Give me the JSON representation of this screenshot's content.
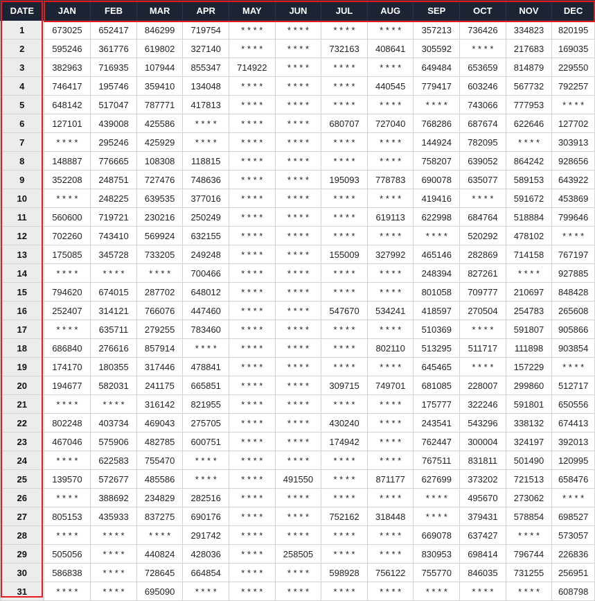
{
  "table": {
    "date_header": "DATE",
    "months": [
      "JAN",
      "FEB",
      "MAR",
      "APR",
      "MAY",
      "JUN",
      "JUL",
      "AUG",
      "SEP",
      "OCT",
      "NOV",
      "DEC"
    ],
    "rows": [
      {
        "date": "1",
        "values": [
          "673025",
          "652417",
          "846299",
          "719754",
          "* * * *",
          "* * * *",
          "* * * *",
          "* * * *",
          "357213",
          "736426",
          "334823",
          "820195"
        ]
      },
      {
        "date": "2",
        "values": [
          "595246",
          "361776",
          "619802",
          "327140",
          "* * * *",
          "* * * *",
          "732163",
          "408641",
          "305592",
          "* * * *",
          "217683",
          "169035"
        ]
      },
      {
        "date": "3",
        "values": [
          "382963",
          "716935",
          "107944",
          "855347",
          "714922",
          "* * * *",
          "* * * *",
          "* * * *",
          "649484",
          "653659",
          "814879",
          "229550"
        ]
      },
      {
        "date": "4",
        "values": [
          "746417",
          "195746",
          "359410",
          "134048",
          "* * * *",
          "* * * *",
          "* * * *",
          "440545",
          "779417",
          "603246",
          "567732",
          "792257"
        ]
      },
      {
        "date": "5",
        "values": [
          "648142",
          "517047",
          "787771",
          "417813",
          "* * * *",
          "* * * *",
          "* * * *",
          "* * * *",
          "* * * *",
          "743066",
          "777953",
          "* * * *"
        ]
      },
      {
        "date": "6",
        "values": [
          "127101",
          "439008",
          "425586",
          "* * * *",
          "* * * *",
          "* * * *",
          "680707",
          "727040",
          "768286",
          "687674",
          "622646",
          "127702"
        ]
      },
      {
        "date": "7",
        "values": [
          "* * * *",
          "295246",
          "425929",
          "* * * *",
          "* * * *",
          "* * * *",
          "* * * *",
          "* * * *",
          "144924",
          "782095",
          "* * * *",
          "303913"
        ]
      },
      {
        "date": "8",
        "values": [
          "148887",
          "776665",
          "108308",
          "118815",
          "* * * *",
          "* * * *",
          "* * * *",
          "* * * *",
          "758207",
          "639052",
          "864242",
          "928656"
        ]
      },
      {
        "date": "9",
        "values": [
          "352208",
          "248751",
          "727476",
          "748636",
          "* * * *",
          "* * * *",
          "195093",
          "778783",
          "690078",
          "635077",
          "589153",
          "643922"
        ]
      },
      {
        "date": "10",
        "values": [
          "* * * *",
          "248225",
          "639535",
          "377016",
          "* * * *",
          "* * * *",
          "* * * *",
          "* * * *",
          "419416",
          "* * * *",
          "591672",
          "453869"
        ]
      },
      {
        "date": "11",
        "values": [
          "560600",
          "719721",
          "230216",
          "250249",
          "* * * *",
          "* * * *",
          "* * * *",
          "619113",
          "622998",
          "684764",
          "518884",
          "799646"
        ]
      },
      {
        "date": "12",
        "values": [
          "702260",
          "743410",
          "569924",
          "632155",
          "* * * *",
          "* * * *",
          "* * * *",
          "* * * *",
          "* * * *",
          "520292",
          "478102",
          "* * * *"
        ]
      },
      {
        "date": "13",
        "values": [
          "175085",
          "345728",
          "733205",
          "249248",
          "* * * *",
          "* * * *",
          "155009",
          "327992",
          "465146",
          "282869",
          "714158",
          "767197"
        ]
      },
      {
        "date": "14",
        "values": [
          "* * * *",
          "* * * *",
          "* * * *",
          "700466",
          "* * * *",
          "* * * *",
          "* * * *",
          "* * * *",
          "248394",
          "827261",
          "* * * *",
          "927885"
        ]
      },
      {
        "date": "15",
        "values": [
          "794620",
          "674015",
          "287702",
          "648012",
          "* * * *",
          "* * * *",
          "* * * *",
          "* * * *",
          "801058",
          "709777",
          "210697",
          "848428"
        ]
      },
      {
        "date": "16",
        "values": [
          "252407",
          "314121",
          "766076",
          "447460",
          "* * * *",
          "* * * *",
          "547670",
          "534241",
          "418597",
          "270504",
          "254783",
          "265608"
        ]
      },
      {
        "date": "17",
        "values": [
          "* * * *",
          "635711",
          "279255",
          "783460",
          "* * * *",
          "* * * *",
          "* * * *",
          "* * * *",
          "510369",
          "* * * *",
          "591807",
          "905866"
        ]
      },
      {
        "date": "18",
        "values": [
          "686840",
          "276616",
          "857914",
          "* * * *",
          "* * * *",
          "* * * *",
          "* * * *",
          "802110",
          "513295",
          "511717",
          "111898",
          "903854"
        ]
      },
      {
        "date": "19",
        "values": [
          "174170",
          "180355",
          "317446",
          "478841",
          "* * * *",
          "* * * *",
          "* * * *",
          "* * * *",
          "645465",
          "* * * *",
          "157229",
          "* * * *"
        ]
      },
      {
        "date": "20",
        "values": [
          "194677",
          "582031",
          "241175",
          "665851",
          "* * * *",
          "* * * *",
          "309715",
          "749701",
          "681085",
          "228007",
          "299860",
          "512717"
        ]
      },
      {
        "date": "21",
        "values": [
          "* * * *",
          "* * * *",
          "316142",
          "821955",
          "* * * *",
          "* * * *",
          "* * * *",
          "* * * *",
          "175777",
          "322246",
          "591801",
          "650556"
        ]
      },
      {
        "date": "22",
        "values": [
          "802248",
          "403734",
          "469043",
          "275705",
          "* * * *",
          "* * * *",
          "430240",
          "* * * *",
          "243541",
          "543296",
          "338132",
          "674413"
        ]
      },
      {
        "date": "23",
        "values": [
          "467046",
          "575906",
          "482785",
          "600751",
          "* * * *",
          "* * * *",
          "174942",
          "* * * *",
          "762447",
          "300004",
          "324197",
          "392013"
        ]
      },
      {
        "date": "24",
        "values": [
          "* * * *",
          "622583",
          "755470",
          "* * * *",
          "* * * *",
          "* * * *",
          "* * * *",
          "* * * *",
          "767511",
          "831811",
          "501490",
          "120995"
        ]
      },
      {
        "date": "25",
        "values": [
          "139570",
          "572677",
          "485586",
          "* * * *",
          "* * * *",
          "491550",
          "* * * *",
          "871177",
          "627699",
          "373202",
          "721513",
          "658476"
        ]
      },
      {
        "date": "26",
        "values": [
          "* * * *",
          "388692",
          "234829",
          "282516",
          "* * * *",
          "* * * *",
          "* * * *",
          "* * * *",
          "* * * *",
          "495670",
          "273062",
          "* * * *"
        ]
      },
      {
        "date": "27",
        "values": [
          "805153",
          "435933",
          "837275",
          "690176",
          "* * * *",
          "* * * *",
          "752162",
          "318448",
          "* * * *",
          "379431",
          "578854",
          "698527"
        ]
      },
      {
        "date": "28",
        "values": [
          "* * * *",
          "* * * *",
          "* * * *",
          "291742",
          "* * * *",
          "* * * *",
          "* * * *",
          "* * * *",
          "669078",
          "637427",
          "* * * *",
          "573057"
        ]
      },
      {
        "date": "29",
        "values": [
          "505056",
          "* * * *",
          "440824",
          "428036",
          "* * * *",
          "258505",
          "* * * *",
          "* * * *",
          "830953",
          "698414",
          "796744",
          "226836"
        ]
      },
      {
        "date": "30",
        "values": [
          "586838",
          "* * * *",
          "728645",
          "664854",
          "* * * *",
          "* * * *",
          "598928",
          "756122",
          "755770",
          "846035",
          "731255",
          "256951"
        ]
      },
      {
        "date": "31",
        "values": [
          "* * * *",
          "* * * *",
          "695090",
          "* * * *",
          "* * * *",
          "* * * *",
          "* * * *",
          "* * * *",
          "* * * *",
          "* * * *",
          "* * * *",
          "608798"
        ]
      }
    ]
  },
  "highlight_color": "#e8191c",
  "header_bg_color": "#1c2434",
  "date_column_bg_color": "#ececec"
}
